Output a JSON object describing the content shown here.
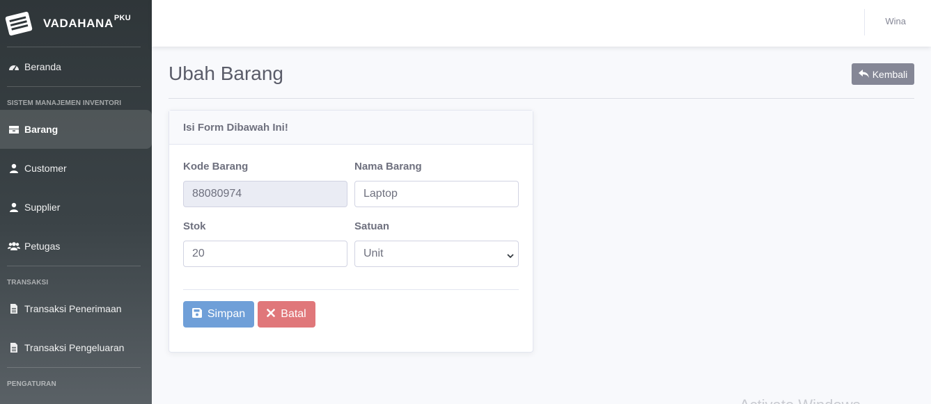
{
  "brand": {
    "name": "VADAHANA",
    "sup": "PKU"
  },
  "sidebar": {
    "dashboard": "Beranda",
    "heading_inventory": "SISTEM MANAJEMEN INVENTORI",
    "items": [
      {
        "label": "Barang",
        "icon": "box-icon",
        "active": true
      },
      {
        "label": "Customer",
        "icon": "user-icon"
      },
      {
        "label": "Supplier",
        "icon": "user-icon"
      },
      {
        "label": "Petugas",
        "icon": "users-icon"
      }
    ],
    "heading_transaction": "TRANSAKSI",
    "transactions": [
      {
        "label": "Transaksi Penerimaan",
        "icon": "file-icon"
      },
      {
        "label": "Transaksi Pengeluaran",
        "icon": "file-icon"
      }
    ],
    "heading_settings": "PENGATURAN"
  },
  "topbar": {
    "user": "Wina"
  },
  "page": {
    "title": "Ubah Barang",
    "back_label": "Kembali"
  },
  "form": {
    "header": "Isi Form Dibawah Ini!",
    "kode_label": "Kode Barang",
    "kode_value": "88080974",
    "nama_label": "Nama Barang",
    "nama_value": "Laptop",
    "stok_label": "Stok",
    "stok_value": "20",
    "satuan_label": "Satuan",
    "satuan_value": "Unit",
    "save_label": "Simpan",
    "cancel_label": "Batal"
  },
  "colors": {
    "sidebar": "#2f3639",
    "save": "#6f9fd8",
    "cancel": "#e0777a",
    "back": "#858796"
  },
  "watermark": "Activate Windows"
}
